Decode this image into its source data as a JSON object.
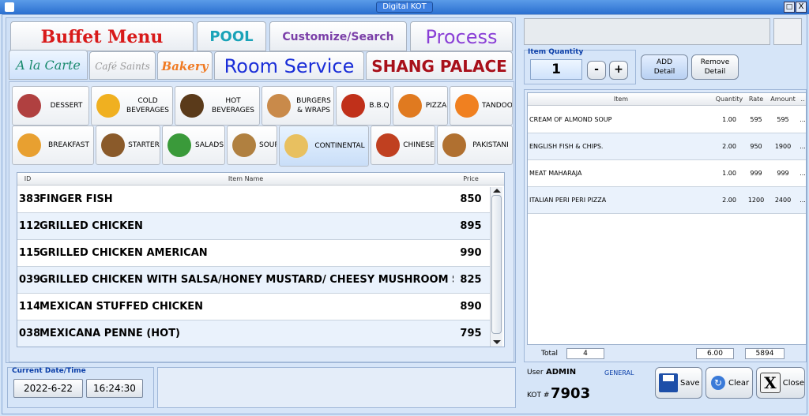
{
  "window": {
    "title": "Digital KOT",
    "close_glyph": "X",
    "restore_glyph": "□"
  },
  "top_tabs": [
    {
      "label": "Buffet Menu",
      "color": "#d81a1a"
    },
    {
      "label": "POOL",
      "color": "#1aa3b8"
    },
    {
      "label": "Customize/Search",
      "color": "#7b3fa8"
    },
    {
      "label": "Process",
      "color": "#8a3fd6"
    }
  ],
  "second_tabs": [
    {
      "label": "A la Carte",
      "color": "#1a8a6e"
    },
    {
      "label": "Café Saints",
      "color": "#9a9a9a"
    },
    {
      "label": "Bakery",
      "color": "#f07a22"
    },
    {
      "label": "Room Service",
      "color": "#1a2ed8"
    },
    {
      "label": "SHANG PALACE",
      "color": "#a8101a"
    }
  ],
  "categories_row1": [
    {
      "label": "DESSERT",
      "icon": "cake-icon",
      "color": "#b04040"
    },
    {
      "label": "COLD BEVERAGES",
      "icon": "juice-icon",
      "color": "#f0b020"
    },
    {
      "label": "HOT BEVERAGES",
      "icon": "coffee-icon",
      "color": "#5a3a1a"
    },
    {
      "label": "BURGERS & WRAPS",
      "icon": "bread-icon",
      "color": "#c98a4a"
    },
    {
      "label": "B.B.Q",
      "icon": "grill-icon",
      "color": "#c0301a"
    },
    {
      "label": "PIZZA",
      "icon": "pizza-icon",
      "color": "#e07a20"
    },
    {
      "label": "TANDOOR",
      "icon": "fire-icon",
      "color": "#f08020"
    }
  ],
  "categories_row2": [
    {
      "label": "BREAKFAST",
      "icon": "breakfast-icon",
      "color": "#e8a030"
    },
    {
      "label": "STARTER",
      "icon": "starter-icon",
      "color": "#8a5a2a"
    },
    {
      "label": "SALADS",
      "icon": "salad-icon",
      "color": "#3a9a3a"
    },
    {
      "label": "SOUP",
      "icon": "soup-icon",
      "color": "#b08040"
    },
    {
      "label": "CONTINENTAL",
      "icon": "egg-icon",
      "color": "#e8c060"
    },
    {
      "label": "CHINESE",
      "icon": "chinese-bowl-icon",
      "color": "#c04020"
    },
    {
      "label": "PAKISTANI",
      "icon": "pot-icon",
      "color": "#b07030"
    }
  ],
  "menu_grid": {
    "headers": {
      "id": "ID",
      "name": "Item Name",
      "price": "Price"
    },
    "rows": [
      {
        "id": "383",
        "name": "FINGER FISH",
        "price": "850"
      },
      {
        "id": "112",
        "name": "GRILLED CHICKEN",
        "price": "895"
      },
      {
        "id": "115",
        "name": "GRILLED CHICKEN AMERICAN",
        "price": "990"
      },
      {
        "id": "039",
        "name": "GRILLED CHICKEN WITH SALSA/HONEY MUSTARD/ CHEESY MUSHROOM SAUCE",
        "price": "825"
      },
      {
        "id": "114",
        "name": "MEXICAN STUFFED CHICKEN",
        "price": "890"
      },
      {
        "id": "038",
        "name": "MEXICANA PENNE (HOT)",
        "price": "795"
      }
    ]
  },
  "datetime": {
    "label": "Current Date/Time",
    "date": "2022-6-22",
    "time": "16:24:30"
  },
  "quantity": {
    "label": "Item Quantity",
    "value": "1",
    "minus": "-",
    "plus": "+"
  },
  "add_detail": {
    "line1": "ADD",
    "line2": "Detail"
  },
  "remove_detail": {
    "line1": "Remove",
    "line2": "Detail"
  },
  "order_grid": {
    "headers": {
      "item": "Item",
      "qty": "Quantity",
      "rate": "Rate",
      "amount": "Amount",
      "more": ".."
    },
    "rows": [
      {
        "item": "CREAM OF ALMOND SOUP",
        "qty": "1.00",
        "rate": "595",
        "amount": "595",
        "more": "..."
      },
      {
        "item": "ENGLISH FISH & CHIPS.",
        "qty": "2.00",
        "rate": "950",
        "amount": "1900",
        "more": "..."
      },
      {
        "item": "MEAT MAHARAJA",
        "qty": "1.00",
        "rate": "999",
        "amount": "999",
        "more": "..."
      },
      {
        "item": "ITALIAN PERI PERI PIZZA",
        "qty": "2.00",
        "rate": "1200",
        "amount": "2400",
        "more": "..."
      }
    ],
    "total_label": "Total",
    "total_items": "4",
    "total_qty": "6.00",
    "total_amount": "5894"
  },
  "user": {
    "label": "User",
    "name": "ADMIN",
    "type": "GENERAL"
  },
  "kot": {
    "label": "KOT #",
    "number": "7903"
  },
  "actions": {
    "save": "Save",
    "clear": "Clear",
    "close": "Close"
  }
}
